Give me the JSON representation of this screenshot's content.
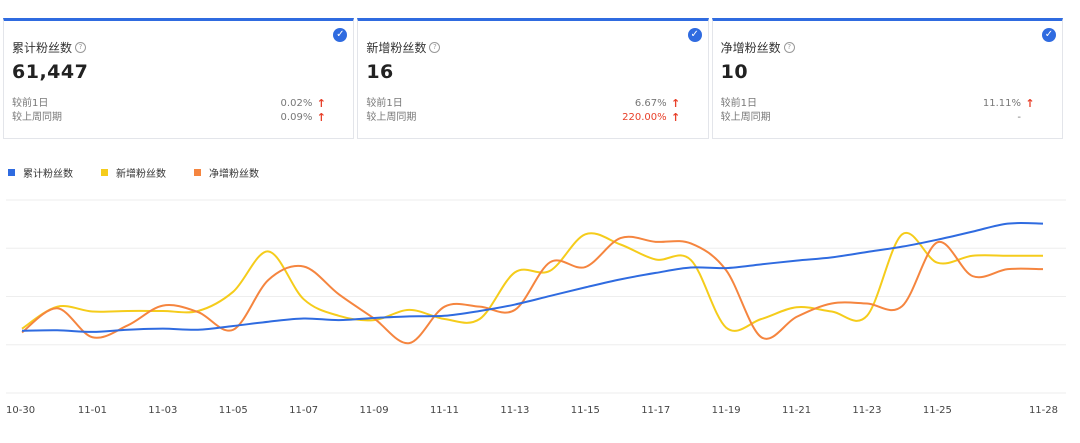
{
  "cards": [
    {
      "label": "累计粉丝数",
      "value": "61,447",
      "cmp1_label": "较前1日",
      "cmp1_value": "0.02%",
      "cmp1_arrow": "↑",
      "cmp2_label": "较上周同期",
      "cmp2_value": "0.09%",
      "cmp2_arrow": "↑",
      "check": "✓"
    },
    {
      "label": "新增粉丝数",
      "value": "16",
      "cmp1_label": "较前1日",
      "cmp1_value": "6.67%",
      "cmp1_arrow": "↑",
      "cmp2_label": "较上周同期",
      "cmp2_value": "220.00%",
      "cmp2_arrow": "↑",
      "check": "✓"
    },
    {
      "label": "净增粉丝数",
      "value": "10",
      "cmp1_label": "较前1日",
      "cmp1_value": "11.11%",
      "cmp1_arrow": "↑",
      "cmp2_label": "较上周同期",
      "cmp2_value": "-",
      "cmp2_arrow": "",
      "check": "✓"
    }
  ],
  "colors": {
    "blue": "#2f6be0",
    "yellow": "#f5cc1b",
    "orange": "#f5853f",
    "accent": "#2f6be0",
    "up": "#e8402a"
  },
  "chart_data": {
    "type": "line",
    "title": "",
    "xlabel": "",
    "ylabel": "",
    "grid": true,
    "legend_position": "top-left",
    "x": [
      "10-30",
      "10-31",
      "11-01",
      "11-02",
      "11-03",
      "11-04",
      "11-05",
      "11-06",
      "11-07",
      "11-08",
      "11-09",
      "11-10",
      "11-11",
      "11-12",
      "11-13",
      "11-14",
      "11-15",
      "11-16",
      "11-17",
      "11-18",
      "11-19",
      "11-20",
      "11-21",
      "11-22",
      "11-23",
      "11-24",
      "11-25",
      "11-26",
      "11-27",
      "11-28"
    ],
    "xticks": [
      "10-30",
      "11-01",
      "11-03",
      "11-05",
      "11-07",
      "11-09",
      "11-11",
      "11-13",
      "11-15",
      "11-17",
      "11-19",
      "11-21",
      "11-23",
      "11-25",
      "11-28"
    ],
    "series": [
      {
        "name": "累计粉丝数",
        "color": "#2f6be0",
        "values": [
          58.0,
          58.5,
          57.0,
          59.0,
          60.0,
          59.0,
          62.5,
          66.5,
          69.5,
          68.0,
          70.0,
          71.5,
          72.0,
          76.5,
          82.5,
          90.5,
          98.5,
          106.0,
          112.0,
          117.0,
          116.5,
          120.0,
          123.5,
          126.5,
          131.5,
          136.5,
          143.0,
          150.5,
          158.0,
          158.0
        ]
      },
      {
        "name": "新增粉丝数",
        "color": "#f5cc1b",
        "values": [
          60.0,
          80.5,
          76.0,
          76.5,
          76.5,
          76.5,
          94.5,
          132.0,
          87.5,
          72.0,
          68.0,
          77.5,
          69.0,
          69.0,
          112.5,
          114.0,
          148.0,
          138.5,
          124.5,
          124.0,
          61.0,
          69.0,
          80.0,
          76.0,
          72.0,
          148.0,
          121.5,
          128.0,
          128.0,
          128.0
        ]
      },
      {
        "name": "净增粉丝数",
        "color": "#f5853f",
        "values": [
          56.5,
          79.0,
          52.0,
          63.0,
          81.5,
          75.5,
          59.0,
          105.5,
          118.0,
          92.0,
          69.5,
          46.5,
          80.5,
          80.5,
          77.5,
          122.0,
          117.5,
          144.5,
          141.0,
          139.5,
          114.5,
          52.0,
          71.0,
          83.5,
          83.5,
          81.0,
          140.5,
          109.0,
          115.5,
          115.5
        ]
      }
    ]
  }
}
